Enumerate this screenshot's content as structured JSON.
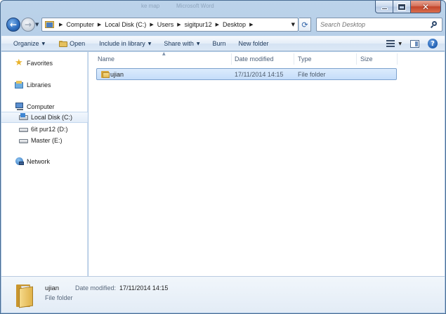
{
  "window": {
    "ghost_title_left": "ke map",
    "ghost_title_right": "Microsoft Word"
  },
  "address": {
    "crumbs": [
      "Computer",
      "Local Disk (C:)",
      "Users",
      "sigitpur12",
      "Desktop"
    ]
  },
  "search": {
    "placeholder": "Search Desktop"
  },
  "toolbar": {
    "organize": "Organize",
    "open": "Open",
    "include_in_library": "Include in library",
    "share_with": "Share with",
    "burn": "Burn",
    "new_folder": "New folder"
  },
  "navpane": {
    "favorites": "Favorites",
    "libraries": "Libraries",
    "computer": "Computer",
    "local_disk": "Local Disk (C:)",
    "drive_d": "6it pur12 (D:)",
    "drive_e": "Master (E:)",
    "network": "Network"
  },
  "columns": {
    "name": "Name",
    "date_modified": "Date modified",
    "type": "Type",
    "size": "Size"
  },
  "files": [
    {
      "name": "ujian",
      "date_modified": "17/11/2014 14:15",
      "type": "File folder",
      "size": ""
    }
  ],
  "details": {
    "name": "ujian",
    "date_label": "Date modified:",
    "date_value": "17/11/2014 14:15",
    "type": "File folder"
  },
  "icons": {
    "back": "back-arrow-icon",
    "forward": "forward-arrow-icon",
    "refresh": "refresh-icon",
    "search": "search-icon",
    "help": "help-icon"
  },
  "colors": {
    "chrome": "#a9c4e2",
    "selection": "#c4ddfa",
    "close_button": "#c3442a"
  }
}
